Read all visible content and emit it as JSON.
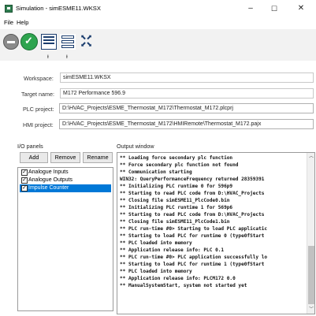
{
  "window": {
    "title": "Simulation - simESME11.WKSX",
    "minimize_icon": "–",
    "maximize_icon": "☐",
    "close_icon": "✕"
  },
  "menu": {
    "items": [
      "File",
      "Help"
    ]
  },
  "toolbar": {
    "pins": [
      "ᵻ",
      "ᵻ"
    ]
  },
  "project": {
    "workspace_label": "Workspace:",
    "workspace_value": "simESME11.WKSX",
    "target_label": "Target name:",
    "target_value": "M172 Performance 596.9",
    "plc_label": "PLC project:",
    "plc_value": "D:\\HVAC_Projects\\ESME_Thermostat_M172\\Thermostat_M172.plcprj",
    "hmi_label": "HMI project:",
    "hmi_value": "D:\\HVAC_Projects\\ESME_Thermostat_M172\\HMIRemote\\Thermostat_M172.pajx"
  },
  "io_panels": {
    "label": "I/O panels",
    "add": "Add",
    "remove": "Remove",
    "rename": "Rename",
    "items": [
      {
        "label": "Analogue Inputs",
        "checked": true,
        "selected": false
      },
      {
        "label": "Analogue Outputs",
        "checked": true,
        "selected": false
      },
      {
        "label": "Impulse Counter",
        "checked": true,
        "selected": true
      }
    ]
  },
  "output": {
    "label": "Output window",
    "lines": [
      "** Loading force secondary plc function",
      "** Force secondary plc function not found",
      "** Communication starting",
      "WIN32: QueryPerformanceFrequency returned 28359391",
      "** Initializing PLC runtime 0 for 596p9",
      "** Starting to read PLC code from D:\\HVAC_Projects",
      "** Closing file simESME11_PlcCode0.bin",
      "** Initializing PLC runtime 1 for 569p6",
      "** Starting to read PLC code from D:\\HVAC_Projects",
      "** Closing file simESME11_PlcCode1.bin",
      "** PLC run-time #0> Starting to load PLC applicatic",
      "** Starting to load PLC for runtime 0 (type0fStart",
      "** PLC loaded into memory",
      "** Application release info: PLC 0.1",
      "** PLC run-time #0> PLC application successfully lo",
      "** Starting to load PLC for runtime 1 (type0fStart",
      "** PLC loaded into memory",
      "** Application release info: PLCM172 0.0",
      "** ManualSystemStart, system not started yet"
    ]
  }
}
